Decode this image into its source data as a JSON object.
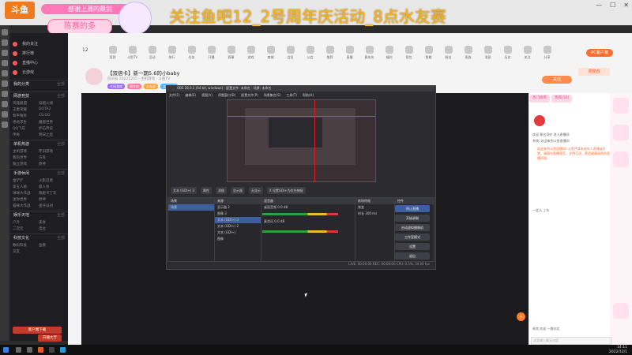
{
  "browser": {
    "logo": "斗鱼",
    "ticker": "感谢上周的鼎剑",
    "banner_sub": "陈赛的多",
    "marquee": "关注鱼吧12_2号周年庆活动_8点水友赛",
    "window_controls": [
      "—",
      "☐",
      "✕"
    ]
  },
  "sidebar": {
    "nav": [
      "我的关注",
      "排行榜",
      "直播中心",
      "云游戏"
    ],
    "sections": [
      {
        "title": "我的分类",
        "count": "全部"
      },
      {
        "title": "网游竞技",
        "count": "全部",
        "items": [
          "英雄联盟",
          "穿越火线",
          "王者荣耀",
          "DOTA2",
          "和平精英",
          "CS:GO",
          "绝地求生",
          "魔兽世界",
          "QQ飞车",
          "炉石传说",
          "传奇",
          "明日之后"
        ]
      },
      {
        "title": "单机热游",
        "count": "全部",
        "items": [
          "主机游戏",
          "怀旧游戏",
          "我的世界",
          "方舟",
          "独立游戏",
          "原神"
        ]
      },
      {
        "title": "手游休闲",
        "count": "全部",
        "items": [
          "金铲铲",
          "火影忍者",
          "第五人格",
          "狼人杀",
          "球球大作战",
          "跑跑卡丁车",
          "迷你世界",
          "原神",
          "猫咪大作战",
          "蛋仔派对"
        ]
      },
      {
        "title": "娱乐天地",
        "count": "全部",
        "items": [
          "户外",
          "美食",
          "二次元",
          "电台"
        ]
      },
      {
        "title": "科技文化",
        "count": "全部",
        "items": [
          "数码科技",
          "鱼教",
          "交友"
        ]
      }
    ],
    "buttons": [
      "客户端下载",
      "开播大厅"
    ]
  },
  "toolbar": {
    "level": "12",
    "items": [
      "签到",
      "斗鱼TV",
      "活动",
      "排行",
      "任务",
      "开播",
      "赛事",
      "游戏",
      "商城",
      "会员",
      "公会",
      "推荐",
      "直播",
      "周年庆",
      "福利",
      "背包",
      "鱼粮",
      "粉丝",
      "贵族",
      "消息",
      "历史",
      "关注",
      "分享",
      "客户端",
      "更多",
      "投诉",
      "举报",
      "观看",
      "设置"
    ],
    "pc_btn": "PC客户端"
  },
  "room": {
    "title": "【双倍卡】新一期5.6的小baby",
    "meta": "房间号 20221205 · 主机游戏 · 斗鱼TV",
    "tags": [
      "主机游戏",
      "周年庆",
      "水友赛",
      "五星主播"
    ],
    "follow": "关注",
    "rank": "周榜首"
  },
  "obs": {
    "title": "OBS 28.0.3 (64 bit, windows) - 配置文件: 未命名 - 场景: 未命名",
    "menu": [
      "文件(F)",
      "编辑(E)",
      "视图(V)",
      "停靠窗口(D)",
      "配置文件(P)",
      "场景集合(S)",
      "工具(T)",
      "帮助(H)"
    ],
    "ctrlbar": [
      "文本 (GDI+) 3",
      "属性",
      "滤镜",
      "显示器",
      "无显示",
      "X 设置GDI+为优先捕捉"
    ],
    "docks": {
      "scenes": {
        "title": "场景",
        "rows": [
          "场景"
        ]
      },
      "sources": {
        "title": "来源",
        "rows": [
          "显示器 2",
          "图像 3",
          "文本 (GDI+) 3",
          "文本 (GDI+) 2",
          "文本 (GDI+)",
          "图像"
        ]
      },
      "mixer": {
        "title": "混音器",
        "rows": [
          "桌面音频 0.0 dB",
          "麦克风 0.0 dB"
        ]
      },
      "transitions": {
        "title": "转场特效",
        "rows": [
          "渐变",
          "时长 300 ms"
        ]
      }
    },
    "controls_title": "控件",
    "controls": [
      "停止直播",
      "开始录制",
      "启动虚拟摄像机",
      "工作室模式",
      "设置",
      "退出"
    ],
    "status": "LIVE: 00:00:00   REC: 00:00:00   CPU: 0.5%, 30.00 fps"
  },
  "chat": {
    "tabs": [
      "热门榜单",
      "贵宾(10)"
    ],
    "messages": [
      "欢迎 莫名奇妙 进入直播间",
      "系统: 欢迎来到斗鱼直播间",
      "一会儿 上车",
      "贵宾 欢迎 一路向北"
    ],
    "notice": "欢迎来到斗鱼直播间! 斗鱼严禁未成年人直播或打赏，请遵守直播规范，文明互动，营造健康绿色的直播环境。",
    "input_placeholder": "这里输入聊天内容"
  },
  "taskbar": {
    "clock_time": "14:11",
    "clock_date": "2022/12/1"
  }
}
